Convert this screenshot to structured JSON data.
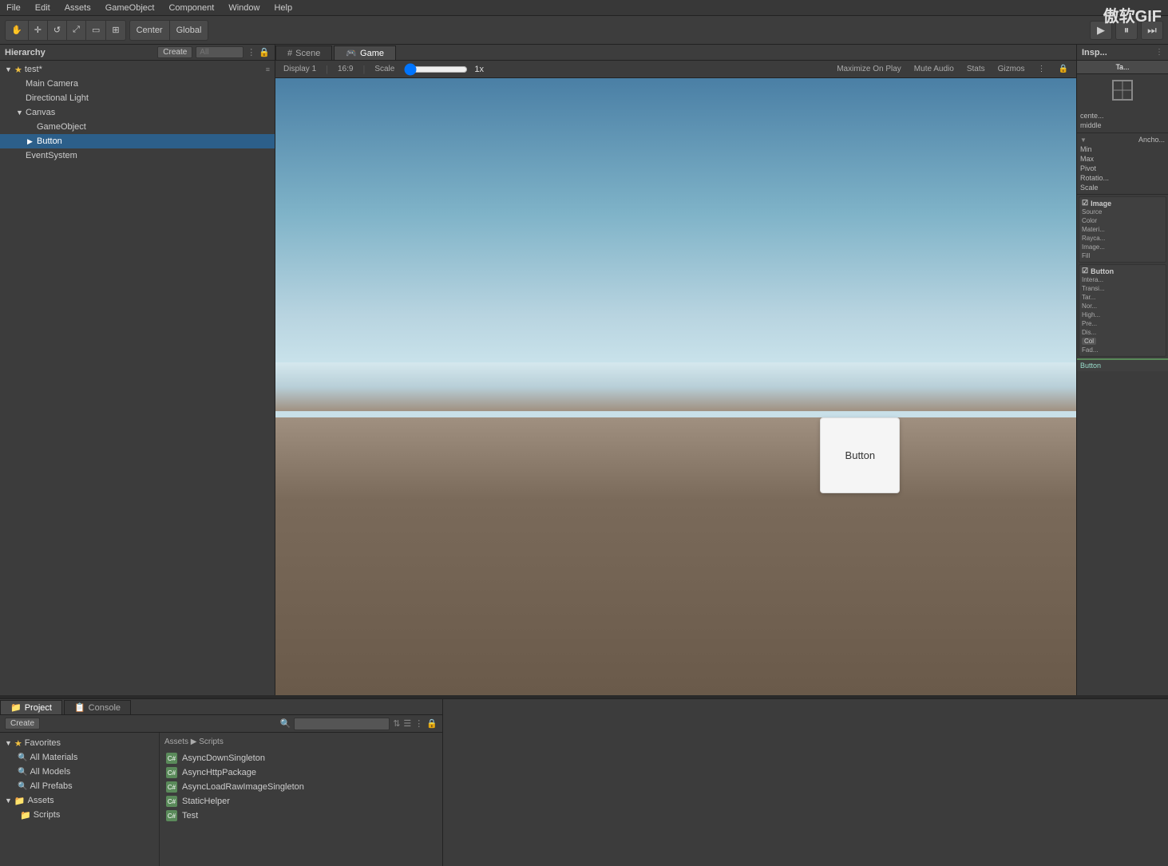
{
  "app": {
    "watermark": "傲软GIF"
  },
  "menubar": {
    "items": [
      "File",
      "Edit",
      "Assets",
      "GameObject",
      "Component",
      "Window",
      "Help"
    ]
  },
  "toolbar": {
    "transform_tools": [
      "⊕",
      "↔",
      "↺",
      "⤢",
      "⊞"
    ],
    "center_label": "Center",
    "global_label": "Global",
    "play_btn": "▶",
    "pause_btn": "⏸",
    "step_btn": "⏭"
  },
  "hierarchy": {
    "title": "Hierarchy",
    "create_label": "Create",
    "search_placeholder": "All",
    "items": [
      {
        "label": "test*",
        "depth": 0,
        "arrow": "▼",
        "star": true
      },
      {
        "label": "Main Camera",
        "depth": 1,
        "arrow": ""
      },
      {
        "label": "Directional Light",
        "depth": 1,
        "arrow": ""
      },
      {
        "label": "Canvas",
        "depth": 1,
        "arrow": "▼"
      },
      {
        "label": "GameObject",
        "depth": 2,
        "arrow": ""
      },
      {
        "label": "Button",
        "depth": 2,
        "arrow": "▶",
        "selected": true
      },
      {
        "label": "EventSystem",
        "depth": 1,
        "arrow": ""
      }
    ]
  },
  "scene_tabs": [
    {
      "label": "Scene",
      "icon": "#",
      "active": false
    },
    {
      "label": "Game",
      "icon": "🎮",
      "active": true
    }
  ],
  "game_toolbar": {
    "display_label": "Display 1",
    "ratio_label": "16:9",
    "scale_label": "Scale",
    "scale_value": "1x",
    "maximize_label": "Maximize On Play",
    "mute_label": "Mute Audio",
    "stats_label": "Stats",
    "gizmos_label": "Gizmos"
  },
  "game_button": {
    "label": "Button"
  },
  "inspector": {
    "title": "Insp...",
    "tabs": [
      "Ta..."
    ],
    "anchor_label": "Ancho...",
    "min_label": "Min",
    "max_label": "Max",
    "pivot_label": "Pivot",
    "rotation_label": "Rotatio...",
    "scale_label": "Scale",
    "source_label": "Source",
    "color_label": "Color",
    "material_label": "Materi...",
    "raycast_label": "Rayca...",
    "image_type_label": "Image...",
    "fill_label": "Fill",
    "interactable_label": "Intera...",
    "transition_label": "Transi...",
    "target_label": "Tar...",
    "normal_label": "Nor...",
    "highlighted_label": "High...",
    "pressed_label": "Pre...",
    "disabled_label": "Dis...",
    "col_label": "Col",
    "fade_label": "Fad...",
    "button_label": "Button"
  },
  "project": {
    "title": "Project",
    "console_label": "Console",
    "create_label": "Create",
    "favorites": {
      "label": "Favorites",
      "items": [
        "All Materials",
        "All Models",
        "All Prefabs"
      ]
    },
    "assets": {
      "label": "Assets",
      "children": [
        "Scripts"
      ]
    },
    "path": "Assets ▶ Scripts",
    "scripts": [
      {
        "name": "AsyncDownSingleton"
      },
      {
        "name": "AsyncHttpPackage"
      },
      {
        "name": "AsyncLoadRawImageSingleton"
      },
      {
        "name": "StaticHelper"
      },
      {
        "name": "Test"
      }
    ]
  }
}
